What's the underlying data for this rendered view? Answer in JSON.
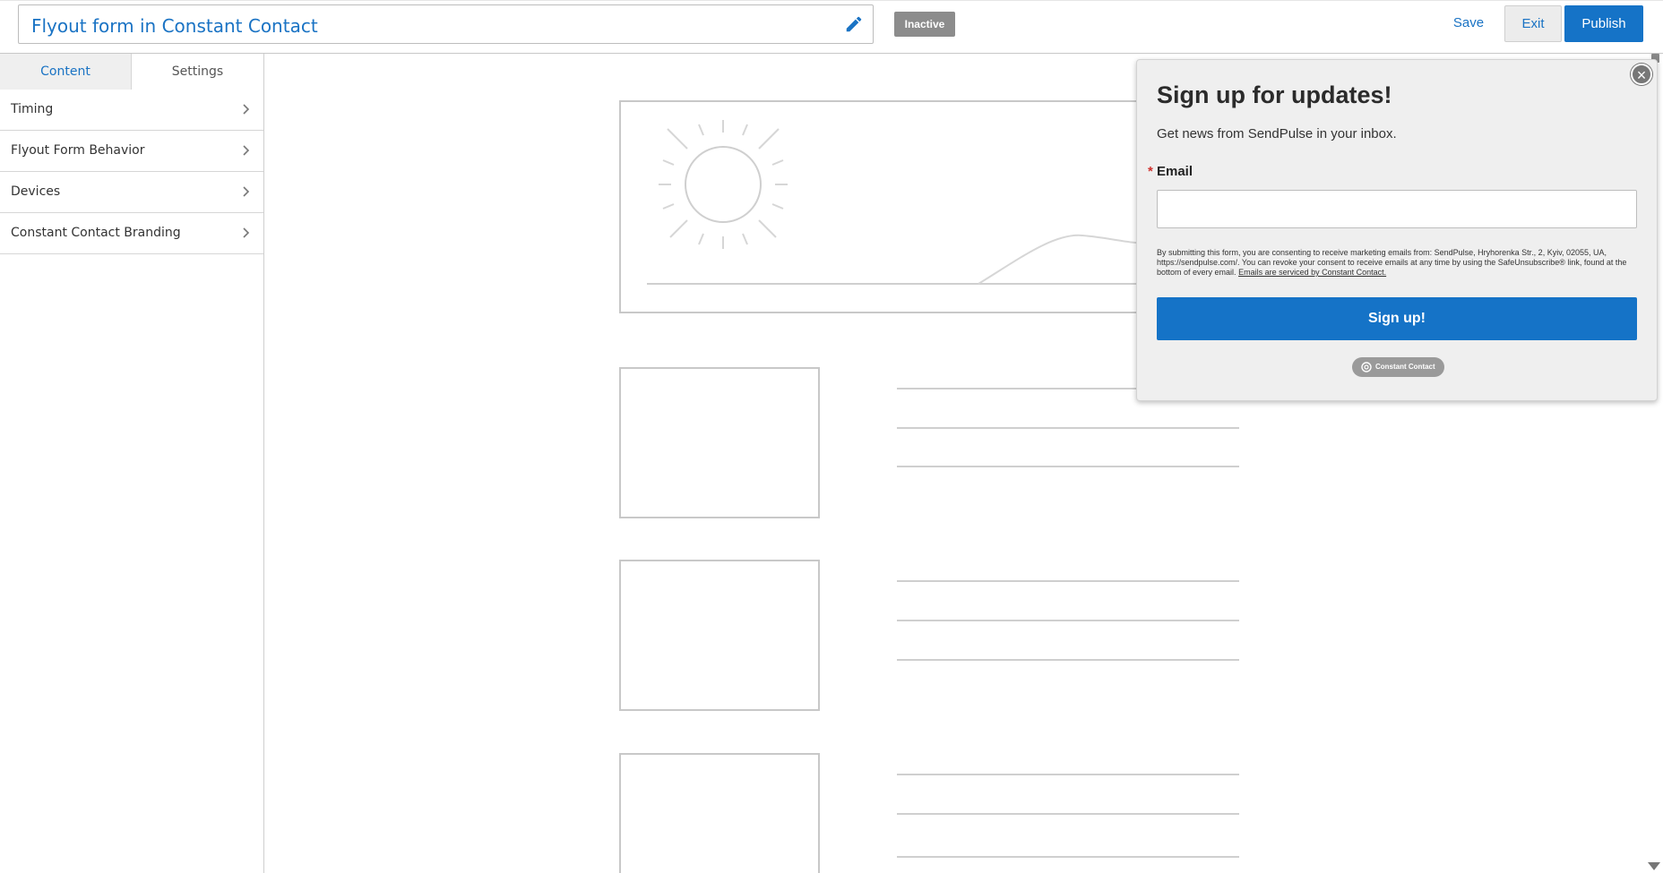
{
  "header": {
    "form_title": "Flyout form in Constant Contact",
    "status": "Inactive",
    "save_label": "Save",
    "exit_label": "Exit",
    "publish_label": "Publish"
  },
  "sidebar": {
    "tabs": [
      {
        "label": "Content",
        "active": true
      },
      {
        "label": "Settings",
        "active": false
      }
    ],
    "items": [
      {
        "label": "Timing"
      },
      {
        "label": "Flyout Form Behavior"
      },
      {
        "label": "Devices"
      },
      {
        "label": "Constant Contact Branding"
      }
    ]
  },
  "flyout": {
    "heading": "Sign up for updates!",
    "subheading": "Get news from SendPulse in your inbox.",
    "email_required_mark": "*",
    "email_label": "Email",
    "email_value": "",
    "consent_text": "By submitting this form, you are consenting to receive marketing emails from: SendPulse, Hryhorenka Str., 2, Kyiv, 02055, UA, https://sendpulse.com/. You can revoke your consent to receive emails at any time by using the SafeUnsubscribe® link, found at the bottom of every email.",
    "consent_link": "Emails are serviced by Constant Contact.",
    "submit_label": "Sign up!",
    "branding_badge": "Constant Contact",
    "close_glyph": "×"
  },
  "icons": {
    "edit": "pencil-icon",
    "chevron": "chevron-right-icon",
    "close": "close-icon",
    "brand": "constant-contact-logo-icon"
  },
  "colors": {
    "accent": "#1573c7",
    "link": "#1a73c4",
    "status_inactive": "#8c8c8c",
    "required": "#d0312d",
    "flyout_bg": "#efefef",
    "placeholder_stroke": "#c8c8c8"
  }
}
